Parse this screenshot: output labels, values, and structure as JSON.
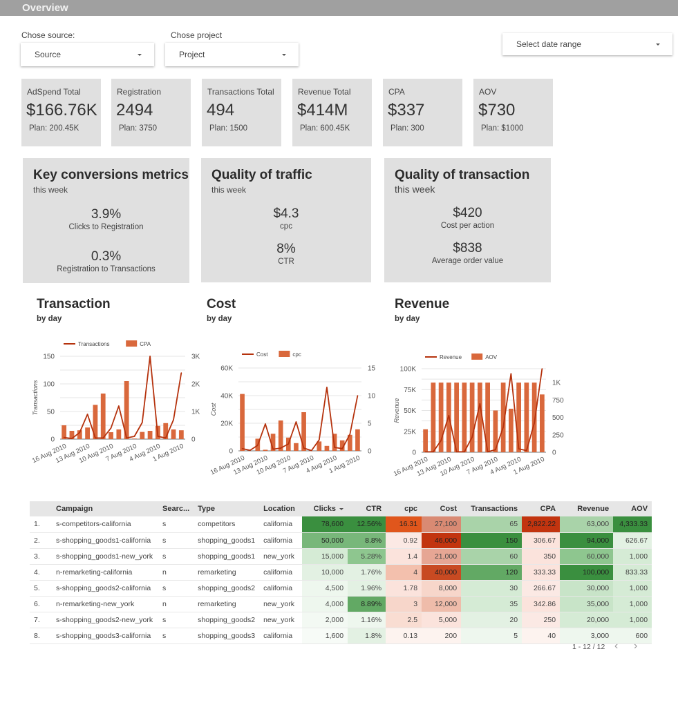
{
  "header": {
    "title": "Overview"
  },
  "filters": {
    "source": {
      "label": "Chose source:",
      "value": "Source"
    },
    "project": {
      "label": "Chose project",
      "value": "Project"
    },
    "date_range": {
      "value": "Select date range"
    }
  },
  "kpis": [
    {
      "label": "AdSpend Total",
      "value": "$166.76K",
      "plan": "Plan: 200.45K"
    },
    {
      "label": "Registration",
      "value": "2494",
      "plan": "Plan: 3750"
    },
    {
      "label": "Transactions Total",
      "value": "494",
      "plan": "Plan: 1500"
    },
    {
      "label": "Revenue Total",
      "value": "$414M",
      "plan": "Plan: 600.45K"
    },
    {
      "label": "CPA",
      "value": "$337",
      "plan": "Plan: 300"
    },
    {
      "label": "AOV",
      "value": "$730",
      "plan": "Plan: $1000"
    }
  ],
  "metric_boxes": [
    {
      "title": "Key conversions metrics",
      "subtitle": "this week",
      "items": [
        {
          "value": "3.9%",
          "label": "Clicks to Registration"
        },
        {
          "value": "0.3%",
          "label": "Registration to Transactions"
        }
      ]
    },
    {
      "title": "Quality of traffic",
      "subtitle": "this week",
      "items": [
        {
          "value": "$4.3",
          "label": "cpc"
        },
        {
          "value": "8%",
          "label": "CTR"
        }
      ]
    },
    {
      "title": "Quality of transaction",
      "subtitle": "this week",
      "items": [
        {
          "value": "$420",
          "label": "Cost per action"
        },
        {
          "value": "$838",
          "label": "Average order value"
        }
      ]
    }
  ],
  "chart_headers": [
    {
      "title": "Transaction",
      "subtitle": "by day"
    },
    {
      "title": "Cost",
      "subtitle": "by day"
    },
    {
      "title": "Revenue",
      "subtitle": "by day"
    }
  ],
  "colors": {
    "line": "#b5320d",
    "bar": "#d9683c",
    "grid": "#e4e4e4",
    "axis": "#777777"
  },
  "chart_data": [
    {
      "type": "bar",
      "title": "Transaction",
      "subtitle": "by day",
      "categories": [
        "16 Aug 2010",
        "15 Aug 2010",
        "14 Aug 2010",
        "13 Aug 2010",
        "12 Aug 2010",
        "11 Aug 2010",
        "10 Aug 2010",
        "9 Aug 2010",
        "8 Aug 2010",
        "7 Aug 2010",
        "6 Aug 2010",
        "5 Aug 2010",
        "4 Aug 2010",
        "3 Aug 2010",
        "2 Aug 2010",
        "1 Aug 2010"
      ],
      "tick_labels": [
        "16 Aug 2010",
        "13 Aug 2010",
        "10 Aug 2010",
        "7 Aug 2010",
        "4 Aug 2010",
        "1 Aug 2010"
      ],
      "series": [
        {
          "name": "Transactions",
          "kind": "line",
          "axis": "left",
          "values": [
            3,
            1,
            12,
            45,
            2,
            2,
            20,
            60,
            2,
            5,
            30,
            150,
            5,
            2,
            35,
            120
          ]
        },
        {
          "name": "CPA",
          "kind": "bar",
          "axis": "right",
          "values": [
            500,
            300,
            320,
            420,
            1240,
            1650,
            250,
            350,
            2100,
            20,
            260,
            300,
            480,
            580,
            350,
            320
          ]
        }
      ],
      "ylabel": "Transactions",
      "ylim": [
        0,
        150
      ],
      "yticks": [
        "0",
        "50",
        "100",
        "150"
      ],
      "y2lim": [
        0,
        3000
      ],
      "y2ticks": [
        "0",
        "1K",
        "2K",
        "3K"
      ],
      "grid": true,
      "legend": "top"
    },
    {
      "type": "bar",
      "title": "Cost",
      "subtitle": "by day",
      "categories": [
        "16 Aug 2010",
        "15 Aug 2010",
        "14 Aug 2010",
        "13 Aug 2010",
        "12 Aug 2010",
        "11 Aug 2010",
        "10 Aug 2010",
        "9 Aug 2010",
        "8 Aug 2010",
        "7 Aug 2010",
        "6 Aug 2010",
        "5 Aug 2010",
        "4 Aug 2010",
        "3 Aug 2010",
        "2 Aug 2010",
        "1 Aug 2010"
      ],
      "tick_labels": [
        "16 Aug 2010",
        "13 Aug 2010",
        "10 Aug 2010",
        "7 Aug 2010",
        "4 Aug 2010",
        "1 Aug 2010"
      ],
      "series": [
        {
          "name": "Cost",
          "kind": "line",
          "axis": "left",
          "values": [
            1600,
            400,
            4000,
            19500,
            1200,
            2000,
            5000,
            21000,
            2000,
            200,
            8000,
            46000,
            2500,
            1600,
            12000,
            40000
          ]
        },
        {
          "name": "cpc",
          "kind": "bar",
          "axis": "right",
          "values": [
            10.3,
            0,
            2.2,
            0.2,
            3.1,
            5.5,
            2.4,
            1.4,
            7.0,
            0,
            1.7,
            0.9,
            3.1,
            1.9,
            2.9,
            3.9
          ]
        }
      ],
      "ylabel": "Cost",
      "ylim": [
        0,
        60000
      ],
      "yticks": [
        "0",
        "20K",
        "40K",
        "60K"
      ],
      "y2lim": [
        0,
        15
      ],
      "y2ticks": [
        "0",
        "5",
        "10",
        "15"
      ],
      "grid": true,
      "legend": "top"
    },
    {
      "type": "bar",
      "title": "Revenue",
      "subtitle": "by day",
      "categories": [
        "16 Aug 2010",
        "15 Aug 2010",
        "14 Aug 2010",
        "13 Aug 2010",
        "12 Aug 2010",
        "11 Aug 2010",
        "10 Aug 2010",
        "9 Aug 2010",
        "8 Aug 2010",
        "7 Aug 2010",
        "6 Aug 2010",
        "5 Aug 2010",
        "4 Aug 2010",
        "3 Aug 2010",
        "2 Aug 2010",
        "1 Aug 2010"
      ],
      "tick_labels": [
        "16 Aug 2010",
        "13 Aug 2010",
        "10 Aug 2010",
        "7 Aug 2010",
        "4 Aug 2010",
        "1 Aug 2010"
      ],
      "series": [
        {
          "name": "Revenue",
          "kind": "line",
          "axis": "left",
          "values": [
            500,
            500,
            14000,
            44000,
            500,
            500,
            18000,
            58000,
            500,
            3000,
            30000,
            94000,
            4000,
            2000,
            35000,
            100000
          ]
        },
        {
          "name": "AOV",
          "kind": "bar",
          "axis": "right",
          "values": [
            330,
            1000,
            1000,
            1000,
            1000,
            1000,
            1000,
            1000,
            1000,
            600,
            1000,
            625,
            1000,
            1000,
            1000,
            830
          ]
        }
      ],
      "ylabel": "Revenue",
      "ylim": [
        0,
        100000
      ],
      "yticks": [
        "0",
        "25K",
        "50K",
        "75K",
        "100K"
      ],
      "y2lim": [
        0,
        1200
      ],
      "y2ticks": [
        "0",
        "250",
        "500",
        "750",
        "1K"
      ],
      "y2tick_values": [
        0,
        250,
        500,
        750,
        1000
      ],
      "grid": true,
      "legend": "top"
    }
  ],
  "table": {
    "columns": [
      "",
      "Campaign",
      "Searc...",
      "Type",
      "Location",
      "Clicks",
      "CTR",
      "cpc",
      "Cost",
      "Transactions",
      "CPA",
      "Revenue",
      "AOV"
    ],
    "sorted_column": "Clicks",
    "rows": [
      [
        "1.",
        "s-competitors-california",
        "s",
        "competitors",
        "california",
        "78,600",
        "12.56%",
        "16.31",
        "27,100",
        "65",
        "2,822.22",
        "63,000",
        "4,333.33"
      ],
      [
        "2.",
        "s-shopping_goods1-california",
        "s",
        "shopping_goods1",
        "california",
        "50,000",
        "8.8%",
        "0.92",
        "46,000",
        "150",
        "306.67",
        "94,000",
        "626.67"
      ],
      [
        "3.",
        "s-shopping_goods1-new_york",
        "s",
        "shopping_goods1",
        "new_york",
        "15,000",
        "5.28%",
        "1.4",
        "21,000",
        "60",
        "350",
        "60,000",
        "1,000"
      ],
      [
        "4.",
        "n-remarketing-california",
        "n",
        "remarketing",
        "california",
        "10,000",
        "1.76%",
        "4",
        "40,000",
        "120",
        "333.33",
        "100,000",
        "833.33"
      ],
      [
        "5.",
        "s-shopping_goods2-california",
        "s",
        "shopping_goods2",
        "california",
        "4,500",
        "1.96%",
        "1.78",
        "8,000",
        "30",
        "266.67",
        "30,000",
        "1,000"
      ],
      [
        "6.",
        "n-remarketing-new_york",
        "n",
        "remarketing",
        "new_york",
        "4,000",
        "8.89%",
        "3",
        "12,000",
        "35",
        "342.86",
        "35,000",
        "1,000"
      ],
      [
        "7.",
        "s-shopping_goods2-new_york",
        "s",
        "shopping_goods2",
        "new_york",
        "2,000",
        "1.16%",
        "2.5",
        "5,000",
        "20",
        "250",
        "20,000",
        "1,000"
      ],
      [
        "8.",
        "s-shopping_goods3-california",
        "s",
        "shopping_goods3",
        "california",
        "1,600",
        "1.8%",
        "0.13",
        "200",
        "5",
        "40",
        "3,000",
        "600"
      ]
    ],
    "cell_colors": [
      [
        "#3a8f3f",
        "#3a8f3f",
        "#e0561c",
        "#d98a73",
        "#a9d3a9",
        "#c2340f",
        "#a9d3a9",
        "#3a8f3f"
      ],
      [
        "#78b77a",
        "#78b77a",
        "#fbe9e4",
        "#c2340f",
        "#3a8f3f",
        "#fbe3dc",
        "#3a8f3f",
        "#e3f1e3"
      ],
      [
        "#d5ebd5",
        "#8ec68f",
        "#fbe3dc",
        "#e6a694",
        "#a9d3a9",
        "#fbe3dc",
        "#8ec68f",
        "#d5ebd5"
      ],
      [
        "#e3f1e3",
        "#e3f1e3",
        "#f3c0ad",
        "#c84a22",
        "#62a964",
        "#fbe3dc",
        "#3a8f3f",
        "#d5ebd5"
      ],
      [
        "#eef7ee",
        "#e3f1e3",
        "#fbe3dc",
        "#f7d6ca",
        "#d5ebd5",
        "#fbe9e4",
        "#c8e4c8",
        "#d5ebd5"
      ],
      [
        "#eef7ee",
        "#62a964",
        "#f7d6ca",
        "#efbcaa",
        "#d5ebd5",
        "#fbe3dc",
        "#c8e4c8",
        "#d5ebd5"
      ],
      [
        "#f3f9f3",
        "#eef7ee",
        "#f9ddd2",
        "#fbe3dc",
        "#e3f1e3",
        "#fbe9e4",
        "#d5ebd5",
        "#d5ebd5"
      ],
      [
        "#f7fbf7",
        "#e3f1e3",
        "#fdf3ef",
        "#fdf3ef",
        "#eef7ee",
        "#fdf3ef",
        "#eef7ee",
        "#eef7ee"
      ]
    ],
    "pagination": {
      "text": "1 - 12 / 12",
      "prev": "‹",
      "next": "›"
    }
  }
}
